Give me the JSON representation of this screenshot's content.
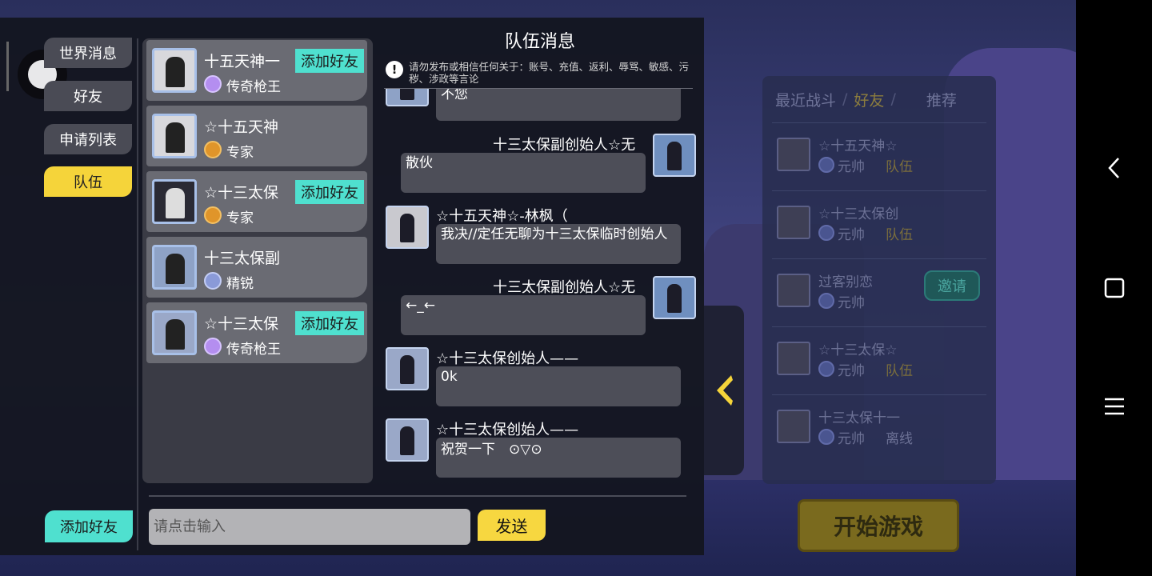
{
  "side_tabs": {
    "world": "世界消息",
    "friends": "好友",
    "requests": "申请列表",
    "team": "队伍"
  },
  "add_friend_label": "添加好友",
  "members": [
    {
      "name": "十五天神一",
      "rank": "传奇枪王",
      "rank_icon": "legend-rank-icon",
      "show_add": true
    },
    {
      "name": "☆十五天神",
      "rank": "专家",
      "rank_icon": "expert-rank-icon",
      "show_add": false
    },
    {
      "name": "☆十三太保",
      "rank": "专家",
      "rank_icon": "expert-rank-icon",
      "show_add": true
    },
    {
      "name": "十三太保副",
      "rank": "精锐",
      "rank_icon": "elite-rank-icon",
      "show_add": false
    },
    {
      "name": "☆十三太保",
      "rank": "传奇枪王",
      "rank_icon": "legend-rank-icon",
      "show_add": true
    }
  ],
  "chat": {
    "title": "队伍消息",
    "warning": "请勿发布或相信任何关于：账号、充值、返利、辱骂、敏感、污秽、涉政等言论",
    "messages": [
      {
        "side": "left",
        "name": "",
        "text": "不您"
      },
      {
        "side": "right",
        "name": "十三太保副创始人☆无",
        "text": "散伙"
      },
      {
        "side": "left",
        "name": "☆十五天神☆-林枫（",
        "text": "我决//定任无聊为十三太保临时创始人"
      },
      {
        "side": "right",
        "name": "十三太保副创始人☆无",
        "text": "←_←"
      },
      {
        "side": "left",
        "name": "☆十三太保创始人——",
        "text": "0k"
      },
      {
        "side": "left",
        "name": "☆十三太保创始人——",
        "text": "祝贺一下　⊙▽⊙"
      }
    ],
    "input_placeholder": "请点击输入",
    "send_label": "发送"
  },
  "friend_panel": {
    "tabs": [
      "最近战斗",
      "好友",
      "推荐"
    ],
    "active_tab": "好友",
    "friends": [
      {
        "name": "☆十五天神☆",
        "rank": "元帅",
        "status": "队伍"
      },
      {
        "name": "☆十三太保创",
        "rank": "元帅",
        "status": "队伍"
      },
      {
        "name": "过客别恋",
        "rank": "元帅",
        "status": "",
        "invite": "邀请"
      },
      {
        "name": "☆十三太保☆",
        "rank": "元帅",
        "status": "队伍"
      },
      {
        "name": "十三太保十一",
        "rank": "元帅",
        "status": "离线"
      }
    ],
    "start_game": "开始游戏"
  },
  "colors": {
    "accent_yellow": "#f5d43a",
    "accent_teal": "#4fe0cf",
    "panel_bg": "#3a3b45",
    "bubble_bg": "#4d4e58"
  }
}
